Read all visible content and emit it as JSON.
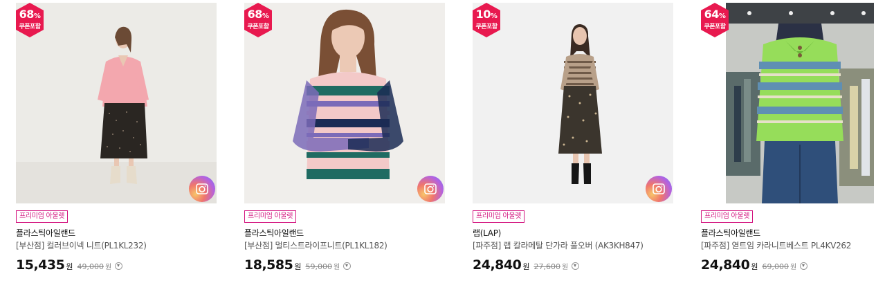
{
  "products": [
    {
      "discount": "68",
      "percent": "%",
      "coupon": "쿠폰포함",
      "tag": "프리미엄 아울렛",
      "brand": "플라스틱아일랜드",
      "name": "[부산점] 컬러브이넥 니트(PL1KL232)",
      "price": "15,435",
      "won": "원",
      "original": "49,000",
      "orig_won": "원",
      "has_camera": true,
      "photo": {
        "bg": "#ecebe7",
        "top": "#f3a7ae",
        "bottom": "#2a2622",
        "skin": "#e9c7b3",
        "hair": "#6b4a35",
        "shoes": "#e6dccb"
      }
    },
    {
      "discount": "68",
      "percent": "%",
      "coupon": "쿠폰포함",
      "tag": "프리미엄 아울렛",
      "brand": "플라스틱아일랜드",
      "name": "[부산점] 멀티스트라이프니트(PL1KL182)",
      "price": "18,585",
      "won": "원",
      "original": "59,000",
      "orig_won": "원",
      "has_camera": true,
      "photo": {
        "bg": "#f0eeeb",
        "hair": "#7a4f35",
        "skin": "#ecc9b5",
        "stripes": [
          "#f3c9c8",
          "#1f6b62",
          "#7b6bb8",
          "#1b2c55",
          "#f3c9c8"
        ]
      }
    },
    {
      "discount": "10",
      "percent": "%",
      "coupon": "쿠폰포함",
      "tag": "프리미엄 아울렛",
      "brand": "랩(LAP)",
      "name": "[파주점] 랩 칼라메탈 단가라 풀오버 (AK3KH847)",
      "price": "24,840",
      "won": "원",
      "original": "27,600",
      "orig_won": "원",
      "has_camera": true,
      "photo": {
        "bg": "#f1f1f1",
        "top": "#b8a089",
        "bottom": "#3b352d",
        "skin": "#e8c5b0",
        "hair": "#3a2a22",
        "shoes": "#161616"
      }
    },
    {
      "discount": "64",
      "percent": "%",
      "coupon": "쿠폰포함",
      "tag": "프리미엄 아울렛",
      "brand": "플라스틱아일랜드",
      "name": "[파주점] 엳트임 카라니트베스트 PL4KV262",
      "price": "24,840",
      "won": "원",
      "original": "69,000",
      "orig_won": "원",
      "has_camera": false,
      "photo": {
        "bg": "#c7c9c5",
        "vest": "#96dd5a",
        "stripe": "#5f8fb3",
        "jeans": "#2f4f7a",
        "shirt": "#2b3145"
      }
    }
  ],
  "colors": {
    "badge_red": "#e8194f",
    "accent_pink": "#d3147f"
  },
  "icons": {
    "badge": "hexagon-badge",
    "camera": "camera-icon",
    "info": "chevron-down-circle-icon"
  }
}
